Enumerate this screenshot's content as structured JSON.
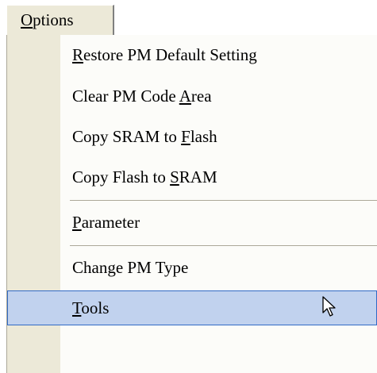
{
  "menubar": {
    "title_prefix": "",
    "title_mnemonic": "O",
    "title_rest": "ptions"
  },
  "items": [
    {
      "pre": "",
      "mn": "R",
      "post": "estore PM Default Setting"
    },
    {
      "pre": "Clear PM Code ",
      "mn": "A",
      "post": "rea"
    },
    {
      "pre": "Copy SRAM to ",
      "mn": "F",
      "post": "lash"
    },
    {
      "pre": "Copy Flash to ",
      "mn": "S",
      "post": "RAM"
    },
    {
      "pre": "",
      "mn": "P",
      "post": "arameter"
    },
    {
      "pre": "Change PM Type",
      "mn": "",
      "post": ""
    },
    {
      "pre": "",
      "mn": "T",
      "post": "ools"
    }
  ],
  "highlighted_item": "Tools",
  "colors": {
    "highlight_fill": "#c1d2ee",
    "highlight_border": "#316ac5",
    "gutter": "#ece9d8"
  }
}
